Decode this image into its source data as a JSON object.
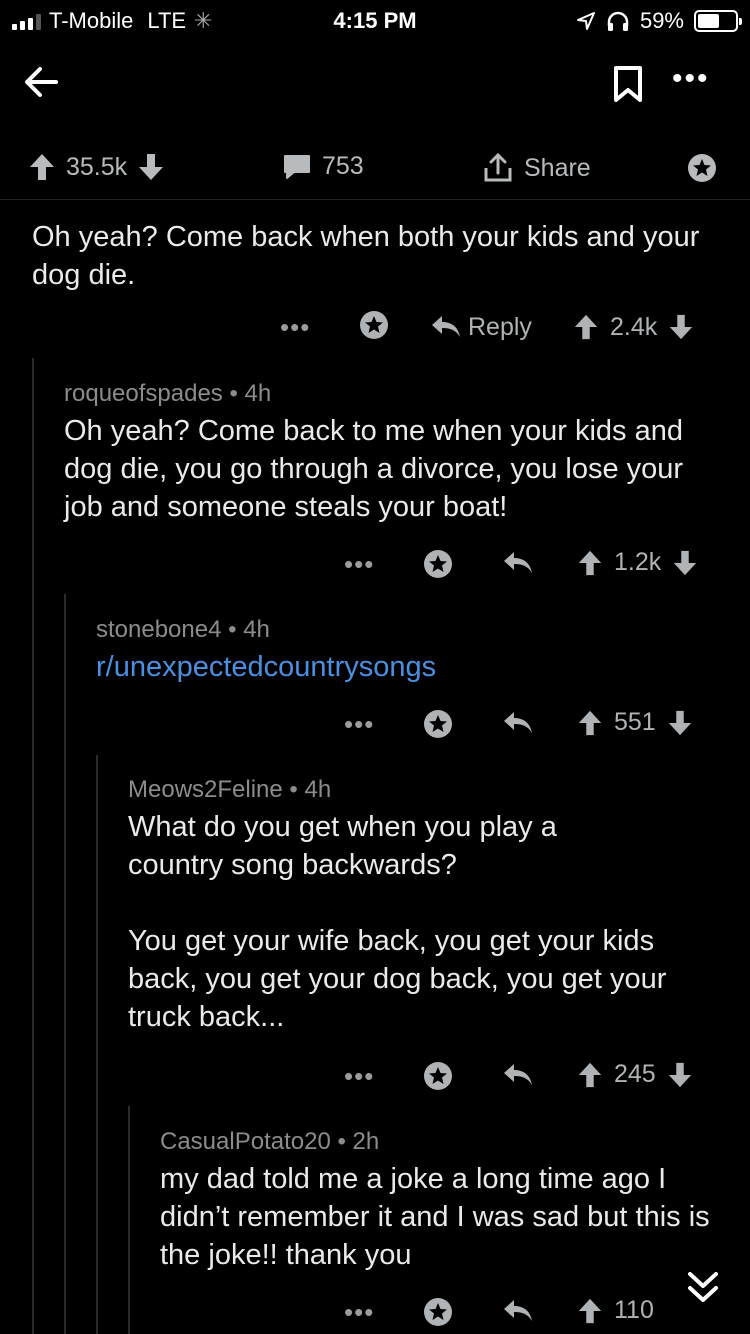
{
  "status_bar": {
    "carrier": "T-Mobile",
    "network": "LTE",
    "time": "4:15 PM",
    "battery_percent": "59%",
    "battery_level": 0.59
  },
  "post_actions": {
    "upvotes": "35.5k",
    "comments": "753",
    "share_label": "Share"
  },
  "comments": [
    {
      "body": "Oh yeah? Come back when both your kids and your dog die.",
      "reply_label": "Reply",
      "score": "2.4k"
    },
    {
      "author": "roqueofspades",
      "age": "4h",
      "body": "Oh yeah? Come back to me when your kids and dog die, you go through a divorce, you lose your job and someone steals your boat!",
      "score": "1.2k"
    },
    {
      "author": "stonebone4",
      "age": "4h",
      "body": "r/unexpectedcountrysongs",
      "score": "551"
    },
    {
      "author": "Meows2Feline",
      "age": "4h",
      "body": "What do you get when you play a country song backwards?",
      "body2": "You get your wife back, you get your kids back, you get your dog back, you get your truck back...",
      "score": "245"
    },
    {
      "author": "CasualPotato20",
      "age": "2h",
      "body": "my dad told me a joke a long time ago I didn’t remember it and I was sad but this is the joke!! thank you",
      "score": "110"
    }
  ],
  "separator": "•",
  "more_dots": "•••",
  "icons": {
    "back": "arrow-left-icon",
    "save": "bookmark-icon",
    "more": "ellipsis-icon",
    "upvote": "arrow-up-icon",
    "downvote": "arrow-down-icon",
    "comment": "speech-bubble-icon",
    "share": "share-icon",
    "award": "award-icon",
    "reply": "reply-arrow-icon",
    "scroll": "double-chevron-down-icon"
  },
  "colors": {
    "background": "#000000",
    "text": "#e8eaeb",
    "meta": "#8a8c8e",
    "link": "#4a90e2"
  }
}
